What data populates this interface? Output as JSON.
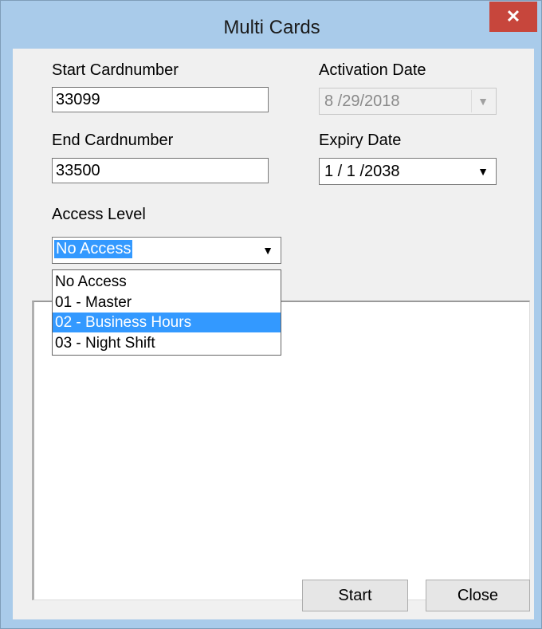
{
  "window": {
    "title": "Multi Cards",
    "close_glyph": "✕"
  },
  "start_card": {
    "label": "Start Cardnumber",
    "value": "33099"
  },
  "end_card": {
    "label": "End Cardnumber",
    "value": "33500"
  },
  "activation": {
    "label": "Activation Date",
    "value": "8 /29/2018",
    "arrow": "▼"
  },
  "expiry": {
    "label": "Expiry Date",
    "value": "1 / 1 /2038",
    "arrow": "▼"
  },
  "access": {
    "label": "Access Level",
    "value": "No Access",
    "arrow": "▼",
    "options": [
      "No Access",
      "01 - Master",
      "02 - Business Hours",
      "03 - Night Shift"
    ],
    "highlighted_index": 2
  },
  "buttons": {
    "start": "Start",
    "close": "Close"
  },
  "colors": {
    "title_bar": "#a9cbea",
    "close_button": "#c7463c",
    "selection": "#3399ff",
    "dialog_bg": "#f0f0f0"
  }
}
